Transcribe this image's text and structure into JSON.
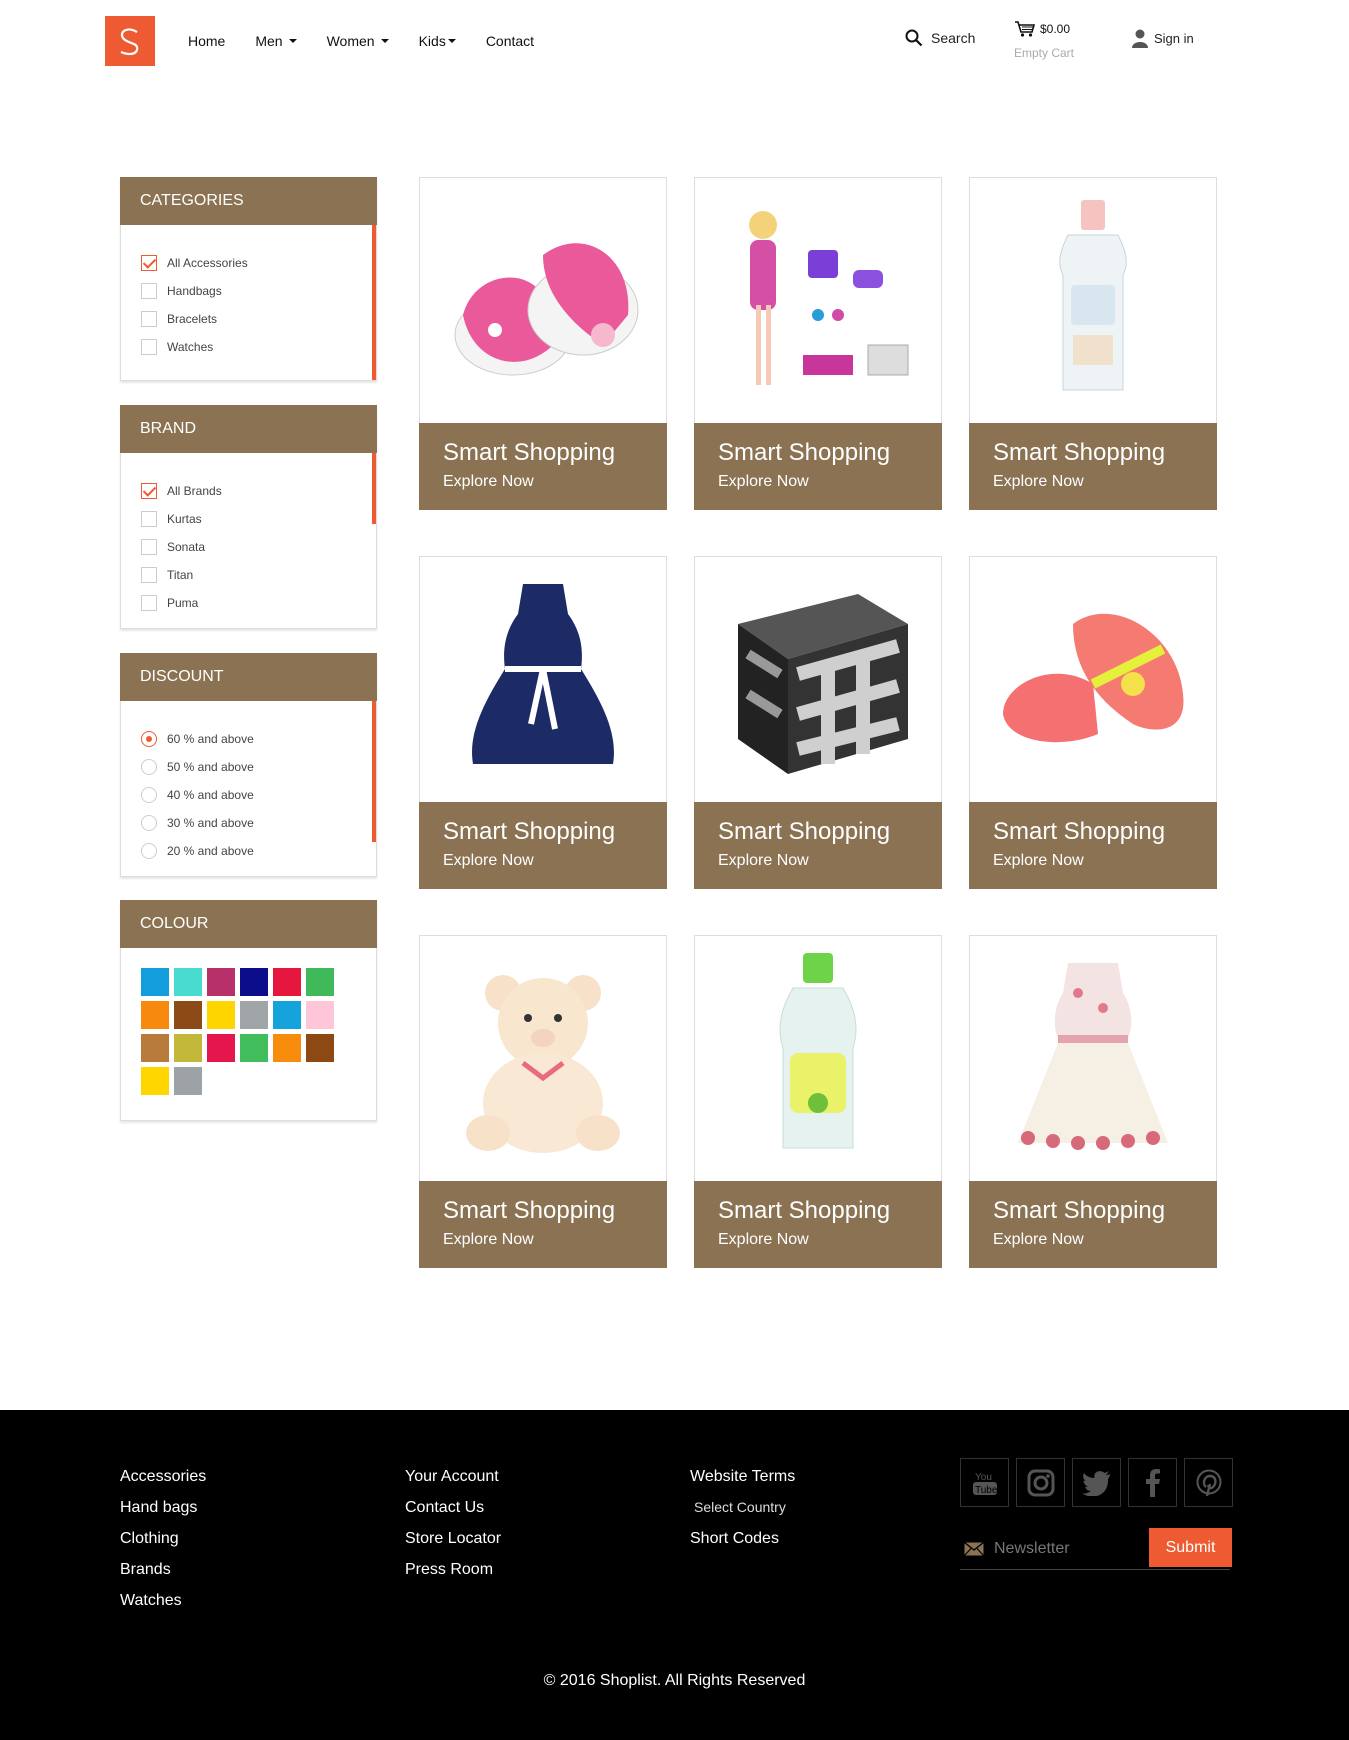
{
  "header": {
    "nav": [
      {
        "label": "Home",
        "dropdown": false
      },
      {
        "label": "Men",
        "dropdown": true
      },
      {
        "label": "Women",
        "dropdown": true
      },
      {
        "label": "Kids",
        "dropdown": true
      },
      {
        "label": "Contact",
        "dropdown": false
      }
    ],
    "search_label": "Search",
    "cart_amount": "$0.00",
    "cart_status": "Empty Cart",
    "signin_label": "Sign in"
  },
  "colors": {
    "brand": "#ee5a31",
    "panel": "#8a7253"
  },
  "sidebar": {
    "categories": {
      "title": "CATEGORIES",
      "items": [
        {
          "label": "All Accessories",
          "checked": true
        },
        {
          "label": "Handbags",
          "checked": false
        },
        {
          "label": "Bracelets",
          "checked": false
        },
        {
          "label": "Watches",
          "checked": false
        }
      ]
    },
    "brand": {
      "title": "BRAND",
      "items": [
        {
          "label": "All Brands",
          "checked": true
        },
        {
          "label": "Kurtas",
          "checked": false
        },
        {
          "label": "Sonata",
          "checked": false
        },
        {
          "label": "Titan",
          "checked": false
        },
        {
          "label": "Puma",
          "checked": false
        }
      ]
    },
    "discount": {
      "title": "DISCOUNT",
      "items": [
        {
          "label": "60 % and above",
          "checked": true
        },
        {
          "label": "50 % and above",
          "checked": false
        },
        {
          "label": "40 % and above",
          "checked": false
        },
        {
          "label": "30 % and above",
          "checked": false
        },
        {
          "label": "20 % and above",
          "checked": false
        }
      ]
    },
    "colour": {
      "title": "COLOUR",
      "swatches": [
        "#139ddc",
        "#47dccf",
        "#b7306a",
        "#0c0d8b",
        "#e5173f",
        "#40b95a",
        "#f7890e",
        "#8c4a16",
        "#ffd500",
        "#a0a5a8",
        "#14a3db",
        "#ffc6d9",
        "#b97b3c",
        "#c4b83b",
        "#e4164b",
        "#42bd5b",
        "#f78c0d",
        "#8e4814",
        "#ffd600",
        "#9da2a6"
      ]
    }
  },
  "products": [
    {
      "title": "Smart Shopping",
      "cta": "Explore Now",
      "icon": "baby-shoes-image"
    },
    {
      "title": "Smart Shopping",
      "cta": "Explore Now",
      "icon": "doll-set-image"
    },
    {
      "title": "Smart Shopping",
      "cta": "Explore Now",
      "icon": "baby-oil-image"
    },
    {
      "title": "Smart Shopping",
      "cta": "Explore Now",
      "icon": "navy-dress-image"
    },
    {
      "title": "Smart Shopping",
      "cta": "Explore Now",
      "icon": "mirror-cube-image"
    },
    {
      "title": "Smart Shopping",
      "cta": "Explore Now",
      "icon": "sandals-image"
    },
    {
      "title": "Smart Shopping",
      "cta": "Explore Now",
      "icon": "teddy-bear-image"
    },
    {
      "title": "Smart Shopping",
      "cta": "Explore Now",
      "icon": "hair-oil-image"
    },
    {
      "title": "Smart Shopping",
      "cta": "Explore Now",
      "icon": "floral-dress-image"
    }
  ],
  "footer": {
    "col1": [
      "Accessories",
      "Hand bags",
      "Clothing",
      "Brands",
      "Watches"
    ],
    "col2": [
      "Your Account",
      "Contact Us",
      "Store Locator",
      "Press Room"
    ],
    "col3": [
      "Website Terms",
      "Select Country",
      "Short Codes"
    ],
    "social": [
      "youtube-icon",
      "instagram-icon",
      "twitter-icon",
      "facebook-icon",
      "pinterest-icon"
    ],
    "newsletter_placeholder": "Newsletter",
    "submit_label": "Submit",
    "copyright": "© 2016 Shoplist. All Rights Reserved"
  }
}
